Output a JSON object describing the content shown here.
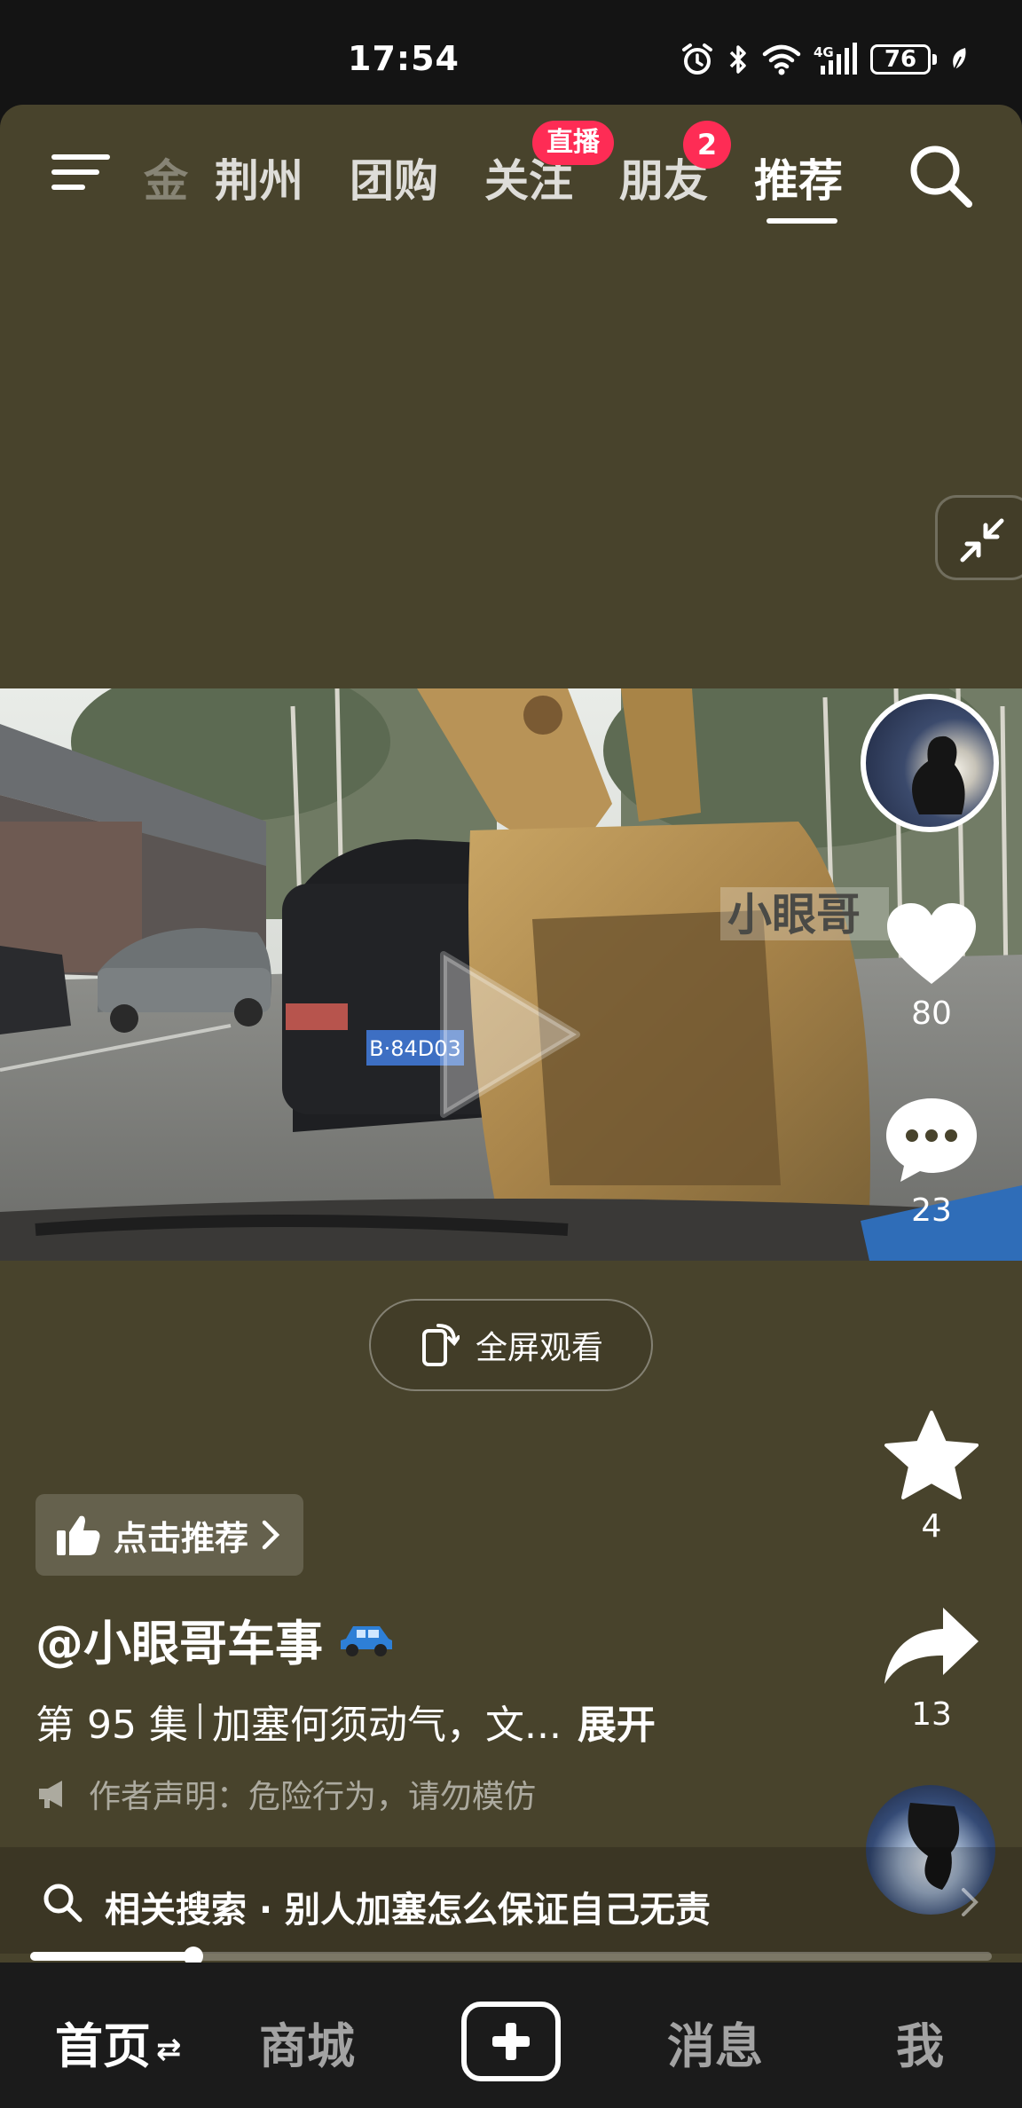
{
  "status_bar": {
    "time": "17:54",
    "battery": "76",
    "network": "4G",
    "icons": [
      "alarm-icon",
      "bluetooth-icon",
      "wifi-icon",
      "signal-icon",
      "battery-icon",
      "leaf-icon"
    ]
  },
  "top_nav": {
    "partial_tab": "金",
    "tabs": [
      "荆州",
      "团购",
      "关注",
      "朋友",
      "推荐"
    ],
    "active_tab": "推荐",
    "live_badge": "直播",
    "friends_badge": "2"
  },
  "video": {
    "watermark": "小眼哥",
    "plate": "B·84D03"
  },
  "actions": {
    "likes": "80",
    "comments": "23",
    "favorites": "4",
    "shares": "13"
  },
  "fullscreen_label": "全屏观看",
  "recommend_label": "点击推荐",
  "author": "@小眼哥车事",
  "description": {
    "episode": "第 95 集",
    "text": "加塞何须动气，文...",
    "expand": "展开"
  },
  "disclaimer": "作者声明：危险行为，请勿模仿",
  "related_search": "相关搜索 · 别人加塞怎么保证自己无责",
  "progress": 0.17,
  "bottom_nav": {
    "home": "首页",
    "home_swap": "⇄",
    "mall": "商城",
    "messages": "消息",
    "me": "我"
  }
}
